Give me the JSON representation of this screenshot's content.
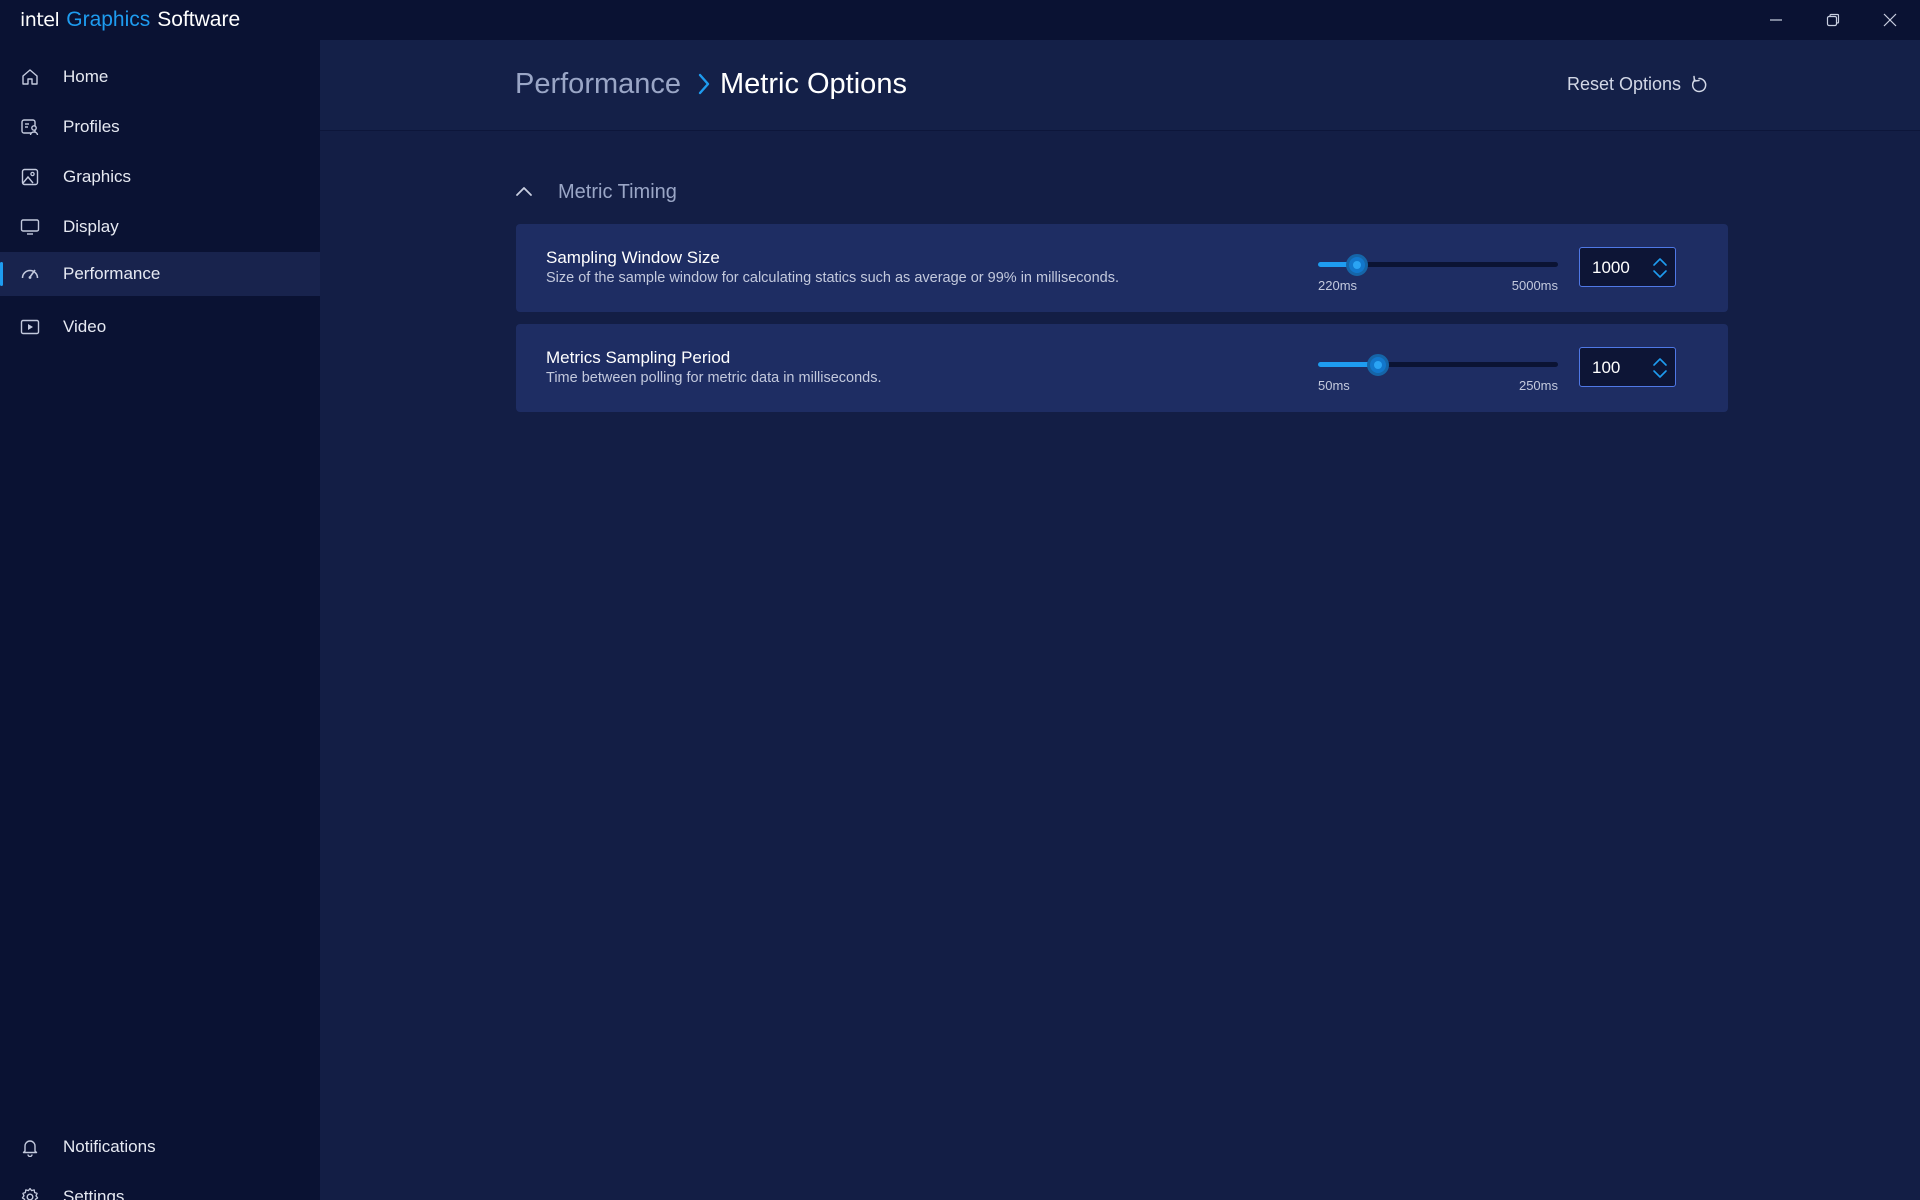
{
  "app": {
    "brand_intel": "intel",
    "brand_graphics": "Graphics",
    "brand_software": "Software"
  },
  "window_controls": [
    "minimize-icon",
    "restore-icon",
    "close-icon"
  ],
  "sidebar": {
    "items": [
      {
        "label": "Home",
        "icon": "home-icon"
      },
      {
        "label": "Profiles",
        "icon": "profiles-icon"
      },
      {
        "label": "Graphics",
        "icon": "graphics-icon"
      },
      {
        "label": "Display",
        "icon": "display-icon"
      },
      {
        "label": "Performance",
        "icon": "performance-icon",
        "active": true
      },
      {
        "label": "Video",
        "icon": "video-icon"
      }
    ],
    "bottom_items": [
      {
        "label": "Notifications",
        "icon": "bell-icon"
      },
      {
        "label": "Settings",
        "icon": "gear-icon"
      }
    ]
  },
  "header": {
    "breadcrumb_parent": "Performance",
    "breadcrumb_current": "Metric Options",
    "reset_label": "Reset Options"
  },
  "section": {
    "title": "Metric Timing",
    "expanded": true
  },
  "settings": [
    {
      "title": "Sampling Window Size",
      "description": "Size of the sample window for calculating statics such as average or 99% in milliseconds.",
      "min_label": "220ms",
      "max_label": "5000ms",
      "min": 220,
      "max": 5000,
      "value": 1000,
      "value_text": "1000"
    },
    {
      "title": "Metrics Sampling Period",
      "description": "Time between polling for metric data in milliseconds.",
      "min_label": "50ms",
      "max_label": "250ms",
      "min": 50,
      "max": 250,
      "value": 100,
      "value_text": "100"
    }
  ],
  "colors": {
    "accent": "#1e9cf0",
    "sidebar_bg": "#0a1233",
    "main_bg": "#131e45",
    "card_bg": "#1e2d63"
  }
}
